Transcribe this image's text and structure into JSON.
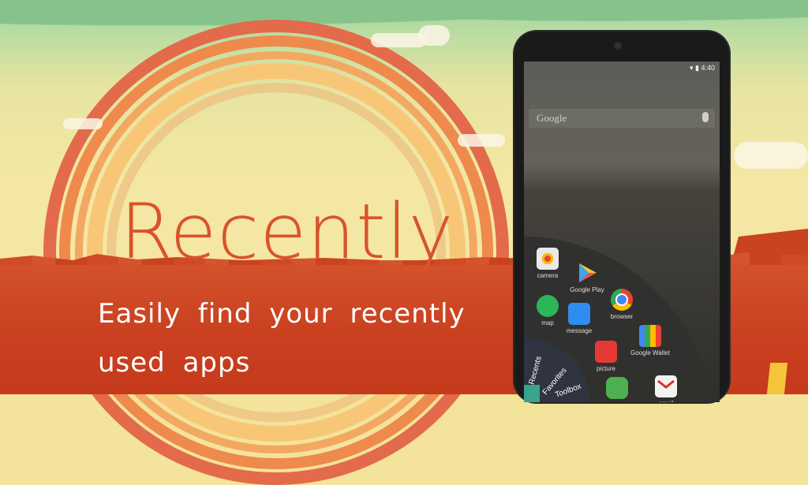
{
  "hero": {
    "title": "Recently",
    "tagline_line1": "Easily find your recently",
    "tagline_line2": "used apps"
  },
  "colors": {
    "brand_red": "#c93f1f",
    "title_color": "#d9532c",
    "sky": "#f4e7a3"
  },
  "phone": {
    "status_time": "4:40",
    "search_placeholder": "Google",
    "menu_tabs": [
      "Recents",
      "Favorites",
      "Toolbox"
    ],
    "apps": [
      {
        "label": "camera",
        "icon": "camera-icon"
      },
      {
        "label": "Google Play",
        "icon": "google-play-icon"
      },
      {
        "label": "map",
        "icon": "hangouts-icon"
      },
      {
        "label": "message",
        "icon": "message-icon"
      },
      {
        "label": "browser",
        "icon": "chrome-icon"
      },
      {
        "label": "picture",
        "icon": "film-icon"
      },
      {
        "label": "Google Wallet",
        "icon": "wallet-icon"
      },
      {
        "label": "music",
        "icon": "gamepad-icon"
      },
      {
        "label": "email",
        "icon": "gmail-icon"
      }
    ]
  }
}
